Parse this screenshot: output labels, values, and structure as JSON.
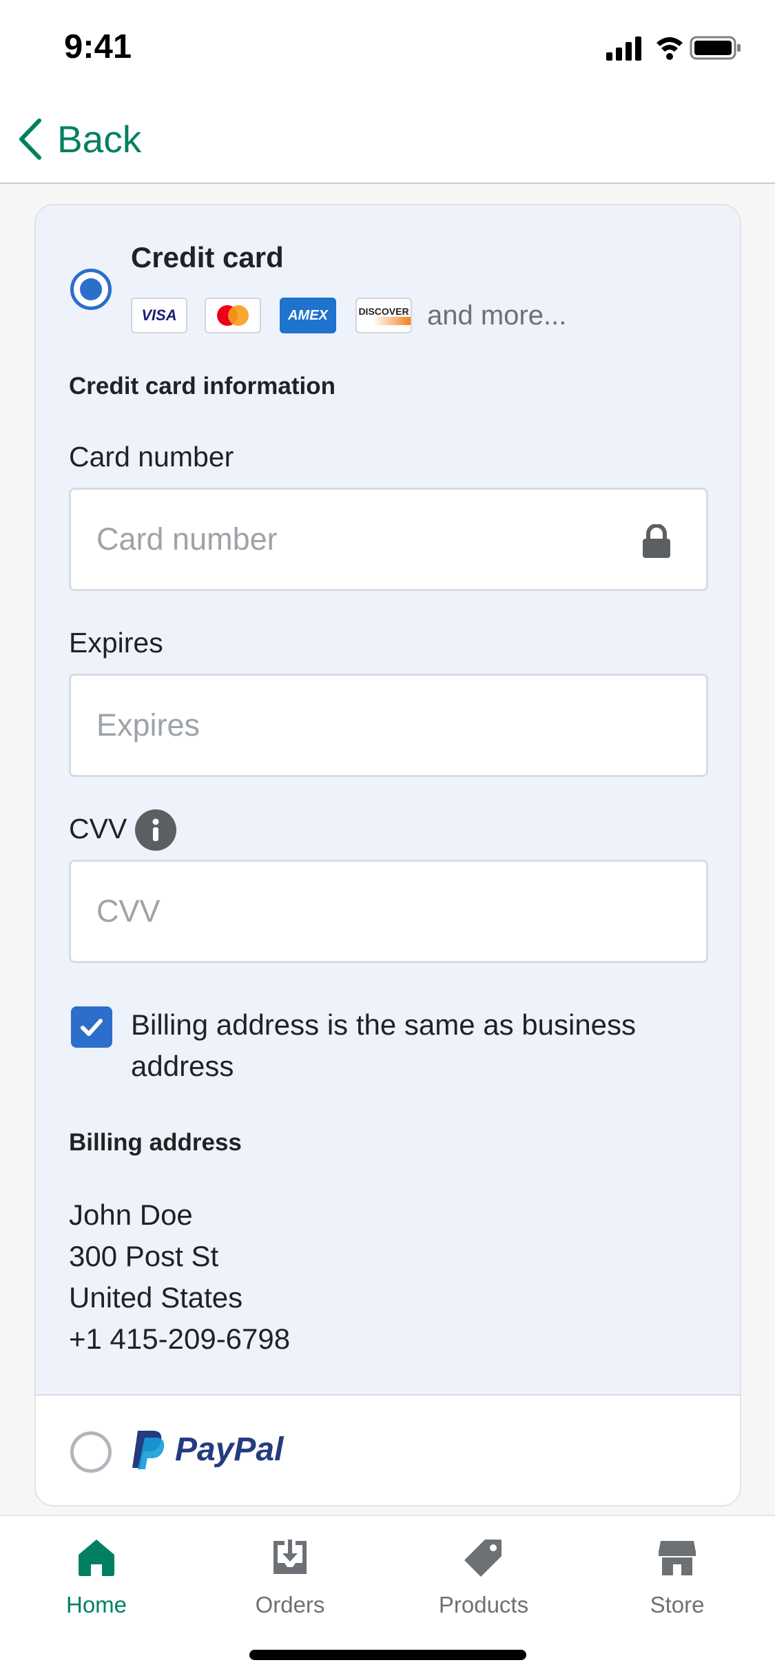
{
  "status_bar": {
    "time": "9:41"
  },
  "nav": {
    "back_label": "Back"
  },
  "payment": {
    "credit_card": {
      "title": "Credit card",
      "brands": [
        "VISA",
        "mastercard",
        "AMEX",
        "DISCOVER"
      ],
      "and_more": "and more...",
      "selected": true
    },
    "cc_info_heading": "Credit card information",
    "card_number": {
      "label": "Card number",
      "placeholder": "Card number"
    },
    "expires": {
      "label": "Expires",
      "placeholder": "Expires"
    },
    "cvv": {
      "label": "CVV",
      "placeholder": "CVV"
    },
    "same_as_business": {
      "label": "Billing address is the same as business address",
      "checked": true
    },
    "billing_heading": "Billing address",
    "billing_address": [
      "John Doe",
      "300 Post St",
      "United States",
      "+1 415-209-6798"
    ],
    "paypal": {
      "label": "PayPal",
      "selected": false
    }
  },
  "tab_bar": {
    "items": [
      {
        "label": "Home",
        "icon": "home-icon",
        "active": true
      },
      {
        "label": "Orders",
        "icon": "orders-icon",
        "active": false
      },
      {
        "label": "Products",
        "icon": "products-tag-icon",
        "active": false
      },
      {
        "label": "Store",
        "icon": "store-icon",
        "active": false
      }
    ]
  },
  "colors": {
    "accent": "#008060",
    "selection_blue": "#2c6ecb",
    "section_bg": "#edf2fb",
    "paypal_dark": "#253b80",
    "paypal_light": "#179bd7"
  }
}
